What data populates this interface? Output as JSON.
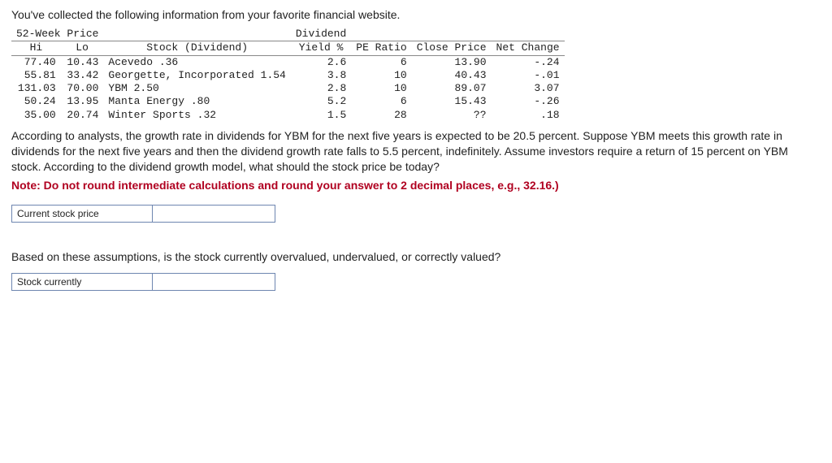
{
  "intro": "You've collected the following information from your favorite financial website.",
  "table": {
    "super_headers": {
      "price": "52-Week Price",
      "dividend": "Dividend"
    },
    "headers": {
      "hi": "Hi",
      "lo": "Lo",
      "stock": "Stock (Dividend)",
      "yield": "Yield %",
      "pe": "PE Ratio",
      "close": "Close Price",
      "net": "Net Change"
    },
    "rows": [
      {
        "hi": "77.40",
        "lo": "10.43",
        "stock": "Acevedo .36",
        "yield": "2.6",
        "pe": "6",
        "close": "13.90",
        "net": "-.24",
        "net_sign": "-"
      },
      {
        "hi": "55.81",
        "lo": "33.42",
        "stock": "Georgette, Incorporated 1.54",
        "yield": "3.8",
        "pe": "10",
        "close": "40.43",
        "net": "-.01",
        "net_sign": "-"
      },
      {
        "hi": "131.03",
        "lo": "70.00",
        "stock": "YBM 2.50",
        "yield": "2.8",
        "pe": "10",
        "close": "89.07",
        "net": "3.07",
        "net_sign": "+"
      },
      {
        "hi": "50.24",
        "lo": "13.95",
        "stock": "Manta Energy .80",
        "yield": "5.2",
        "pe": "6",
        "close": "15.43",
        "net": "-.26",
        "net_sign": "-"
      },
      {
        "hi": "35.00",
        "lo": "20.74",
        "stock": "Winter Sports .32",
        "yield": "1.5",
        "pe": "28",
        "close": "??",
        "net": ".18",
        "net_sign": "+"
      }
    ]
  },
  "paragraph": "According to analysts, the growth rate in dividends for YBM for the next five years is expected to be 20.5 percent. Suppose YBM meets this growth rate in dividends for the next five years and then the dividend growth rate falls to 5.5 percent, indefinitely. Assume investors require a return of 15 percent on YBM stock. According to the dividend growth model, what should the stock price be today?",
  "note": "Note: Do not round intermediate calculations and round your answer to 2 decimal places, e.g., 32.16.)",
  "answer1_label": "Current stock price",
  "question2": "Based on these assumptions, is the stock currently overvalued, undervalued, or correctly valued?",
  "answer2_label": "Stock currently"
}
